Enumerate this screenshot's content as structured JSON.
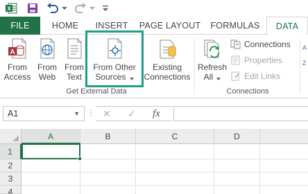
{
  "quick_access": {
    "icons": [
      "excel-app-icon",
      "save-icon",
      "undo-icon",
      "redo-icon",
      "customize-qat-icon"
    ],
    "colors": {
      "excel_green": "#217346",
      "save_purple": "#7b3fa0"
    }
  },
  "tabs": [
    {
      "label": "FILE",
      "active": false
    },
    {
      "label": "HOME",
      "active": false
    },
    {
      "label": "INSERT",
      "active": false
    },
    {
      "label": "PAGE LAYOUT",
      "active": false
    },
    {
      "label": "FORMULAS",
      "active": false
    },
    {
      "label": "DATA",
      "active": true
    }
  ],
  "ribbon": {
    "get_external_data": {
      "group_label": "Get External Data",
      "buttons": [
        {
          "line1": "From",
          "line2": "Access",
          "icon": "access-db-icon"
        },
        {
          "line1": "From",
          "line2": "Web",
          "icon": "web-globe-icon"
        },
        {
          "line1": "From",
          "line2": "Text",
          "icon": "text-file-icon"
        },
        {
          "line1": "From Other",
          "line2": "Sources",
          "icon": "other-sources-icon",
          "has_dropdown": true,
          "highlighted": true
        },
        {
          "line1": "Existing",
          "line2": "Connections",
          "icon": "existing-connections-icon"
        }
      ]
    },
    "connections": {
      "group_label": "Connections",
      "refresh_all": {
        "line1": "Refresh",
        "line2": "All",
        "icon": "refresh-all-icon",
        "has_dropdown": true
      },
      "small_buttons": [
        {
          "label": "Connections",
          "icon": "connections-icon",
          "enabled": true
        },
        {
          "label": "Properties",
          "icon": "properties-icon",
          "enabled": false
        },
        {
          "label": "Edit Links",
          "icon": "edit-links-icon",
          "enabled": false
        }
      ]
    },
    "highlight_color": "#1aa086"
  },
  "formula_bar": {
    "name_box": "A1",
    "cancel_symbol": "✕",
    "enter_symbol": "✓",
    "fx_label": "fx",
    "formula_value": ""
  },
  "sheet": {
    "columns": [
      "A",
      "B",
      "C",
      "D"
    ],
    "rows": [
      "1",
      "2",
      "3",
      "4"
    ],
    "active_cell": "A1"
  }
}
